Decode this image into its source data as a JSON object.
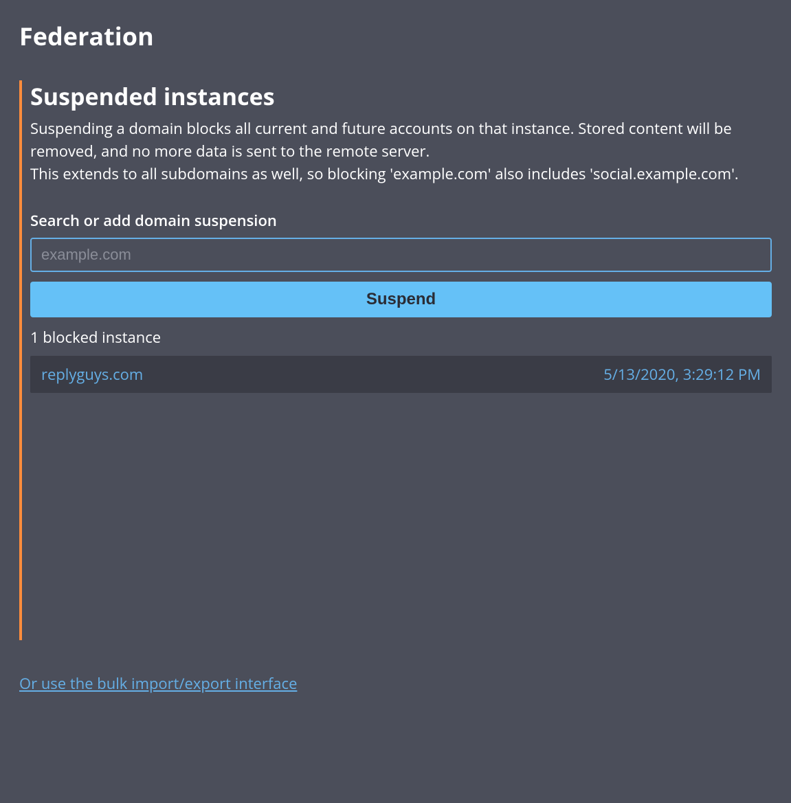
{
  "page_title": "Federation",
  "section": {
    "title": "Suspended instances",
    "description_line1": "Suspending a domain blocks all current and future accounts on that instance. Stored content will be removed, and no more data is sent to the remote server.",
    "description_line2": "This extends to all subdomains as well, so blocking 'example.com' also includes 'social.example.com'."
  },
  "form": {
    "label": "Search or add domain suspension",
    "placeholder": "example.com",
    "button_label": "Suspend"
  },
  "blocked_count_text": "1 blocked instance",
  "instances": [
    {
      "domain": "replyguys.com",
      "date": "5/13/2020, 3:29:12 PM"
    }
  ],
  "bulk_link_text": "Or use the bulk import/export interface"
}
